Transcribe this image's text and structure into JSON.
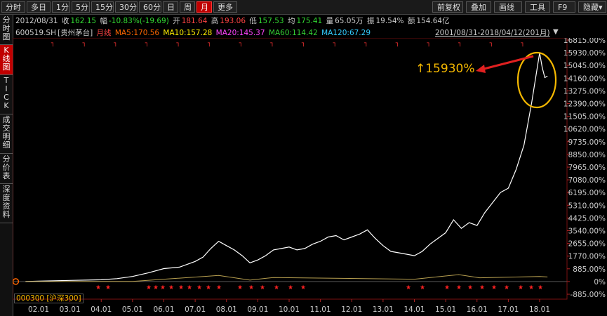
{
  "toolbar": {
    "periods": [
      "分时",
      "多日",
      "1分",
      "5分",
      "15分",
      "30分",
      "60分",
      "日",
      "周",
      "月",
      "更多"
    ],
    "active_period": "月",
    "right_buttons": [
      "前复权",
      "叠加",
      "画线",
      "工具",
      "F9",
      "隐藏▾"
    ]
  },
  "sidebar": [
    {
      "label": "分时图",
      "active": false
    },
    {
      "label": "K线图",
      "active": true
    },
    {
      "label": "TICK",
      "active": false
    },
    {
      "label": "成交明细",
      "active": false
    },
    {
      "label": "分价表",
      "active": false
    },
    {
      "label": "深度资料",
      "active": false
    }
  ],
  "info_bar": {
    "date": "2012/08/31",
    "close_label": "收",
    "close": "162.15",
    "amp_label": "幅",
    "amp": "-10.83%(-19.69)",
    "open_label": "开",
    "open": "181.64",
    "high_label": "高",
    "high": "193.06",
    "low_label": "低",
    "low": "157.53",
    "avg_label": "均",
    "avg": "175.41",
    "vol_label": "量",
    "vol": "65.05万",
    "swing_label": "振",
    "swing": "19.54%",
    "amount_label": "额",
    "amount": "154.64亿"
  },
  "ma_bar": {
    "code": "600519.SH",
    "name": "[贵州茅台]",
    "period": "月线",
    "ma5": "MA5:170.56",
    "ma10": "MA10:157.28",
    "ma20": "MA20:145.37",
    "ma60": "MA60:114.42",
    "ma120": "MA120:67.29",
    "range": "2001/08/31-2018/04/12(201月)"
  },
  "colors": {
    "ma5": "#ff6600",
    "ma10": "#ffee00",
    "ma20": "#ff44ff",
    "ma60": "#33cc33",
    "ma120": "#33ccff",
    "price": "#ffffff",
    "index": "#b8a050",
    "annotation": "#f5b800",
    "arrow": "#e02020"
  },
  "annotation": {
    "text": "↑15930%"
  },
  "compare_label": "000300 [沪深300]",
  "chart_data": {
    "type": "line",
    "y_axis_type": "percent",
    "y_ticks": [
      "16815.00%",
      "15930.00%",
      "15045.00%",
      "14160.00%",
      "13275.00%",
      "12390.00%",
      "11505.00%",
      "10620.00%",
      "9735.00%",
      "8850.00%",
      "7965.00%",
      "7080.00%",
      "6195.00%",
      "5310.00%",
      "4425.00%",
      "3540.00%",
      "2655.00%",
      "1770.00%",
      "885.00%",
      "0%",
      "-885.00%"
    ],
    "x_ticks": [
      "02.01",
      "03.01",
      "04.01",
      "05.01",
      "06.01",
      "07.01",
      "08.01",
      "09.01",
      "10.01",
      "11.01",
      "12.01",
      "13.01",
      "14.01",
      "15.01",
      "16.01",
      "17.01",
      "18.01"
    ],
    "ylim": [
      -885,
      16815
    ],
    "series": [
      {
        "name": "600519.SH",
        "x": [
          "2001.08",
          "2002.01",
          "2003.01",
          "2004.01",
          "2004.07",
          "2005.01",
          "2005.07",
          "2006.01",
          "2006.07",
          "2007.01",
          "2007.04",
          "2007.07",
          "2007.10",
          "2008.01",
          "2008.04",
          "2008.07",
          "2008.10",
          "2009.01",
          "2009.04",
          "2009.07",
          "2009.10",
          "2010.01",
          "2010.04",
          "2010.07",
          "2010.10",
          "2011.01",
          "2011.04",
          "2011.07",
          "2011.10",
          "2012.01",
          "2012.04",
          "2012.07",
          "2012.10",
          "2013.01",
          "2013.04",
          "2013.07",
          "2013.10",
          "2014.01",
          "2014.04",
          "2014.07",
          "2014.10",
          "2015.01",
          "2015.04",
          "2015.07",
          "2015.10",
          "2016.01",
          "2016.04",
          "2016.07",
          "2016.10",
          "2017.01",
          "2017.04",
          "2017.07",
          "2017.10",
          "2018.01",
          "2018.02",
          "2018.03",
          "2018.04"
        ],
        "values": [
          0,
          30,
          80,
          120,
          200,
          350,
          600,
          900,
          1000,
          1400,
          1700,
          2300,
          2800,
          2500,
          2200,
          1800,
          1300,
          1500,
          1800,
          2200,
          2300,
          2400,
          2200,
          2300,
          2600,
          2800,
          3100,
          3200,
          2900,
          3100,
          3300,
          3600,
          3000,
          2500,
          2100,
          2000,
          1900,
          1800,
          2100,
          2600,
          3000,
          3400,
          4300,
          3700,
          4100,
          3900,
          4800,
          5500,
          6200,
          6500,
          7800,
          9500,
          12500,
          15930,
          14900,
          14200,
          14300
        ]
      },
      {
        "name": "沪深300",
        "x": [
          "2001.08",
          "2005.01",
          "2007.10",
          "2008.10",
          "2009.07",
          "2014.01",
          "2015.06",
          "2016.02",
          "2018.01",
          "2018.04"
        ],
        "values": [
          0,
          10,
          420,
          100,
          280,
          160,
          480,
          260,
          350,
          320
        ]
      }
    ]
  }
}
